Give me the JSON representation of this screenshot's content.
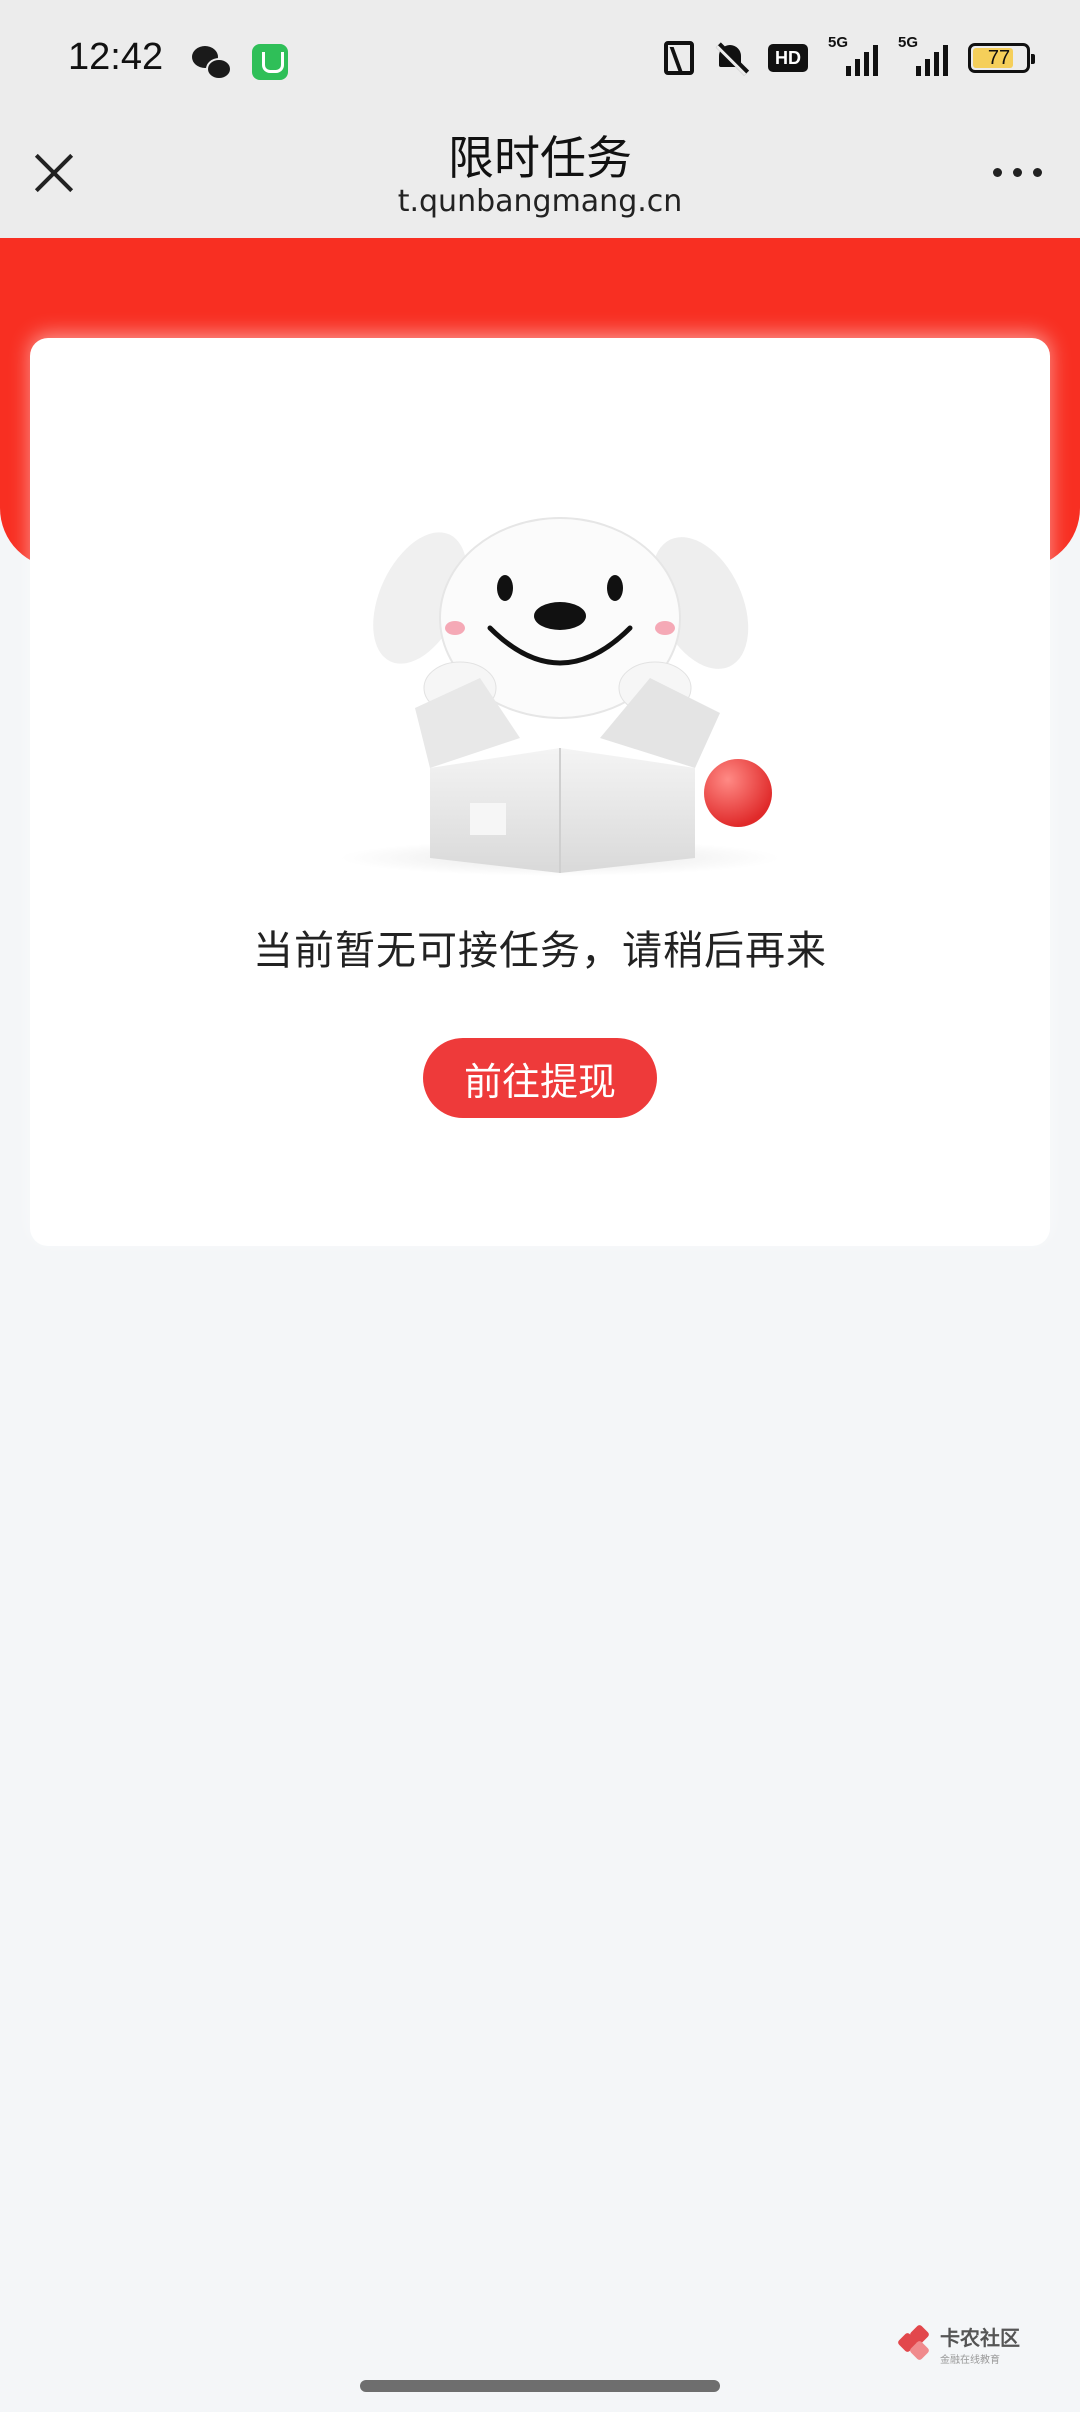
{
  "status_bar": {
    "time": "12:42",
    "signal_1": "5G",
    "signal_2": "5G",
    "hd_label": "HD",
    "battery_level": "77",
    "battery_fraction": 0.77
  },
  "header": {
    "title": "限时任务",
    "url": "t.qunbangmang.cn"
  },
  "empty_state": {
    "message": "当前暂无可接任务，请稍后再来",
    "button_label": "前往提现"
  },
  "watermark": {
    "title": "卡农社区",
    "subtitle": "金融在线教育"
  },
  "colors": {
    "header_red": "#f82f22",
    "button_red": "#ee3a3a",
    "background": "#f4f6f8",
    "battery_yellow": "#f5cf5a"
  },
  "icons": [
    "wechat-icon",
    "app-store-icon",
    "nfc-icon",
    "mute-icon",
    "hd-icon",
    "signal-icon",
    "battery-icon",
    "close-icon",
    "more-icon"
  ]
}
